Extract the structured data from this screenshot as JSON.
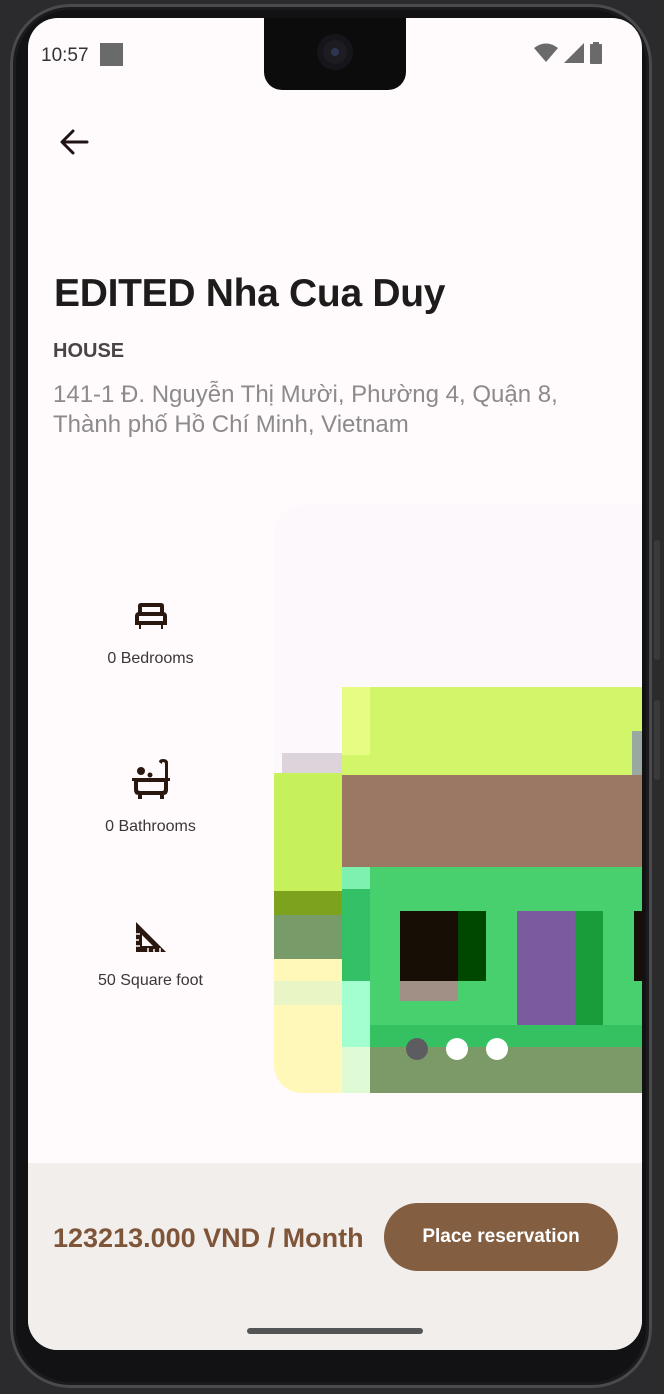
{
  "status_bar": {
    "time": "10:57",
    "icons": [
      "wifi-icon",
      "signal-icon",
      "battery-icon"
    ]
  },
  "header": {
    "back_icon": "arrow-left-icon"
  },
  "property": {
    "title": "EDITED Nha Cua Duy",
    "type": "HOUSE",
    "address": "141-1 Đ. Nguyễn Thị Mười, Phường 4, Quận 8, Thành phố Hồ Chí Minh, Vietnam"
  },
  "features": [
    {
      "icon": "bed-icon",
      "label": "0 Bedrooms"
    },
    {
      "icon": "bathtub-icon",
      "label": "0 Bathrooms"
    },
    {
      "icon": "ruler-square-icon",
      "label": "50 Square foot"
    }
  ],
  "carousel": {
    "page_count": 3,
    "active_index": 0
  },
  "footer": {
    "price": "123213.000 VND / Month",
    "reserve_label": "Place reservation"
  },
  "colors": {
    "accent": "#845e40",
    "price_text": "#7f5539",
    "background": "#fffbfd",
    "bottom_bar": "#f2eeec"
  }
}
